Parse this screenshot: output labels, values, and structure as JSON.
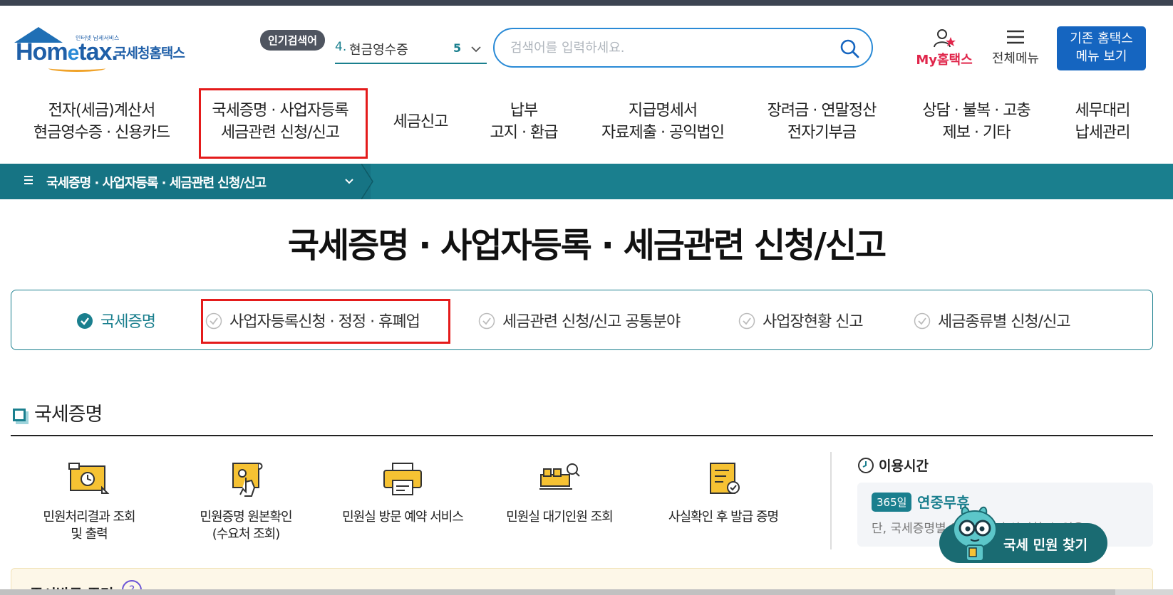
{
  "header": {
    "logo_tagline": "인터넷 납세서비스",
    "logo_word_1": "Hom",
    "logo_word_e": "e",
    "logo_word_2": "tax.",
    "logo_korean": "국세청홈택스",
    "popular_badge": "인기검색어",
    "popular_rank_num": "4.",
    "popular_rank_text": "현금영수증",
    "popular_rank_index": "5",
    "search_placeholder": "검색어를 입력하세요.",
    "search_value": "",
    "my_label": "My홈택스",
    "all_menu_label": "전체메뉴",
    "old_menu_line1": "기존 홈택스",
    "old_menu_line2": "메뉴 보기"
  },
  "gnb": [
    {
      "line1": "전자(세금)계산서",
      "line2": "현금영수증 · 신용카드"
    },
    {
      "line1": "국세증명 · 사업자등록",
      "line2": "세금관련 신청/신고"
    },
    {
      "line1": "세금신고",
      "line2": ""
    },
    {
      "line1": "납부",
      "line2": "고지 · 환급"
    },
    {
      "line1": "지급명세서",
      "line2": "자료제출 · 공익법인"
    },
    {
      "line1": "장려금 · 연말정산",
      "line2": "전자기부금"
    },
    {
      "line1": "상담 · 불복 · 고충",
      "line2": "제보 · 기타"
    },
    {
      "line1": "세무대리",
      "line2": "납세관리"
    }
  ],
  "breadcrumb": {
    "label": "국세증명 · 사업자등록 · 세금관련 신청/신고"
  },
  "page_title": "국세증명 · 사업자등록 · 세금관련 신청/신고",
  "tabs": [
    {
      "label": "국세증명",
      "active": true
    },
    {
      "label": "사업자등록신청 · 정정 · 휴폐업",
      "active": false
    },
    {
      "label": "세금관련 신청/신고 공통분야",
      "active": false
    },
    {
      "label": "사업장현황 신고",
      "active": false
    },
    {
      "label": "세금종류별 신청/신고",
      "active": false
    }
  ],
  "section": {
    "title": "국세증명",
    "services": [
      {
        "line1": "민원처리결과 조회",
        "line2": "및 출력",
        "icon": "document-result-icon"
      },
      {
        "line1": "민원증명 원본확인",
        "line2": "(수요처 조회)",
        "icon": "certificate-touch-icon"
      },
      {
        "line1": "민원실 방문 예약 서비스",
        "line2": "",
        "icon": "printer-icon"
      },
      {
        "line1": "민원실 대기인원 조회",
        "line2": "",
        "icon": "waiting-room-icon"
      },
      {
        "line1": "사실확인 후 발급 증명",
        "line2": "",
        "icon": "verified-document-icon"
      }
    ],
    "hours": {
      "title": "이용시간",
      "badge": "365일",
      "value": "연중무휴",
      "note": "단, 국세증명별 이용시간이 상이할 수 있음"
    }
  },
  "finder": {
    "label": "국세 민원 찾기"
  },
  "notice": {
    "title": "즉시발급 증명",
    "help": "?"
  },
  "colors": {
    "accent": "#1a7f8e",
    "brand": "#1f5fa8",
    "highlight_box": "#e41b1b",
    "my": "#e0264b",
    "old_menu_bg": "#1565c0"
  }
}
